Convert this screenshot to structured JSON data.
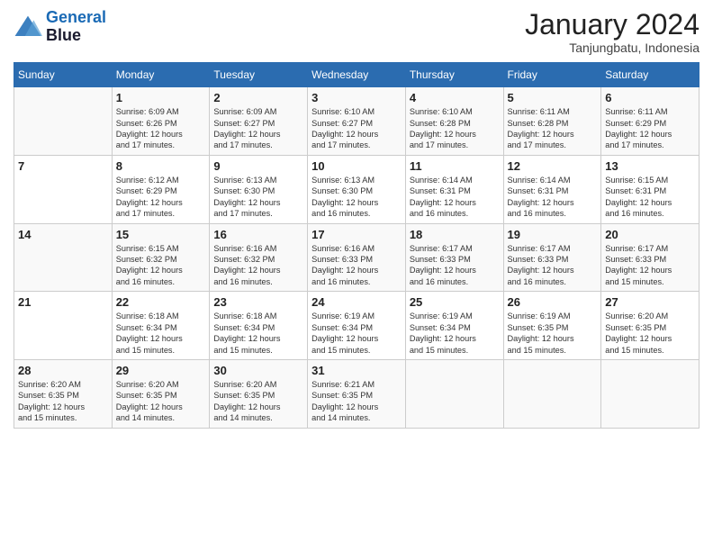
{
  "header": {
    "logo_line1": "General",
    "logo_line2": "Blue",
    "month": "January 2024",
    "location": "Tanjungbatu, Indonesia"
  },
  "weekdays": [
    "Sunday",
    "Monday",
    "Tuesday",
    "Wednesday",
    "Thursday",
    "Friday",
    "Saturday"
  ],
  "weeks": [
    [
      {
        "day": "",
        "info": ""
      },
      {
        "day": "1",
        "info": "Sunrise: 6:09 AM\nSunset: 6:26 PM\nDaylight: 12 hours\nand 17 minutes."
      },
      {
        "day": "2",
        "info": "Sunrise: 6:09 AM\nSunset: 6:27 PM\nDaylight: 12 hours\nand 17 minutes."
      },
      {
        "day": "3",
        "info": "Sunrise: 6:10 AM\nSunset: 6:27 PM\nDaylight: 12 hours\nand 17 minutes."
      },
      {
        "day": "4",
        "info": "Sunrise: 6:10 AM\nSunset: 6:28 PM\nDaylight: 12 hours\nand 17 minutes."
      },
      {
        "day": "5",
        "info": "Sunrise: 6:11 AM\nSunset: 6:28 PM\nDaylight: 12 hours\nand 17 minutes."
      },
      {
        "day": "6",
        "info": "Sunrise: 6:11 AM\nSunset: 6:29 PM\nDaylight: 12 hours\nand 17 minutes."
      }
    ],
    [
      {
        "day": "7",
        "info": ""
      },
      {
        "day": "8",
        "info": "Sunrise: 6:12 AM\nSunset: 6:29 PM\nDaylight: 12 hours\nand 17 minutes."
      },
      {
        "day": "9",
        "info": "Sunrise: 6:13 AM\nSunset: 6:30 PM\nDaylight: 12 hours\nand 17 minutes."
      },
      {
        "day": "10",
        "info": "Sunrise: 6:13 AM\nSunset: 6:30 PM\nDaylight: 12 hours\nand 16 minutes."
      },
      {
        "day": "11",
        "info": "Sunrise: 6:14 AM\nSunset: 6:31 PM\nDaylight: 12 hours\nand 16 minutes."
      },
      {
        "day": "12",
        "info": "Sunrise: 6:14 AM\nSunset: 6:31 PM\nDaylight: 12 hours\nand 16 minutes."
      },
      {
        "day": "13",
        "info": "Sunrise: 6:15 AM\nSunset: 6:31 PM\nDaylight: 12 hours\nand 16 minutes."
      }
    ],
    [
      {
        "day": "14",
        "info": ""
      },
      {
        "day": "15",
        "info": "Sunrise: 6:15 AM\nSunset: 6:32 PM\nDaylight: 12 hours\nand 16 minutes."
      },
      {
        "day": "16",
        "info": "Sunrise: 6:16 AM\nSunset: 6:32 PM\nDaylight: 12 hours\nand 16 minutes."
      },
      {
        "day": "17",
        "info": "Sunrise: 6:16 AM\nSunset: 6:33 PM\nDaylight: 12 hours\nand 16 minutes."
      },
      {
        "day": "18",
        "info": "Sunrise: 6:17 AM\nSunset: 6:33 PM\nDaylight: 12 hours\nand 16 minutes."
      },
      {
        "day": "19",
        "info": "Sunrise: 6:17 AM\nSunset: 6:33 PM\nDaylight: 12 hours\nand 16 minutes."
      },
      {
        "day": "20",
        "info": "Sunrise: 6:17 AM\nSunset: 6:33 PM\nDaylight: 12 hours\nand 15 minutes."
      }
    ],
    [
      {
        "day": "21",
        "info": ""
      },
      {
        "day": "22",
        "info": "Sunrise: 6:18 AM\nSunset: 6:34 PM\nDaylight: 12 hours\nand 15 minutes."
      },
      {
        "day": "23",
        "info": "Sunrise: 6:18 AM\nSunset: 6:34 PM\nDaylight: 12 hours\nand 15 minutes."
      },
      {
        "day": "24",
        "info": "Sunrise: 6:19 AM\nSunset: 6:34 PM\nDaylight: 12 hours\nand 15 minutes."
      },
      {
        "day": "25",
        "info": "Sunrise: 6:19 AM\nSunset: 6:34 PM\nDaylight: 12 hours\nand 15 minutes."
      },
      {
        "day": "26",
        "info": "Sunrise: 6:19 AM\nSunset: 6:35 PM\nDaylight: 12 hours\nand 15 minutes."
      },
      {
        "day": "27",
        "info": "Sunrise: 6:20 AM\nSunset: 6:35 PM\nDaylight: 12 hours\nand 15 minutes."
      }
    ],
    [
      {
        "day": "28",
        "info": "Sunrise: 6:20 AM\nSunset: 6:35 PM\nDaylight: 12 hours\nand 15 minutes."
      },
      {
        "day": "29",
        "info": "Sunrise: 6:20 AM\nSunset: 6:35 PM\nDaylight: 12 hours\nand 14 minutes."
      },
      {
        "day": "30",
        "info": "Sunrise: 6:20 AM\nSunset: 6:35 PM\nDaylight: 12 hours\nand 14 minutes."
      },
      {
        "day": "31",
        "info": "Sunrise: 6:21 AM\nSunset: 6:35 PM\nDaylight: 12 hours\nand 14 minutes."
      },
      {
        "day": "",
        "info": ""
      },
      {
        "day": "",
        "info": ""
      },
      {
        "day": "",
        "info": ""
      }
    ]
  ]
}
